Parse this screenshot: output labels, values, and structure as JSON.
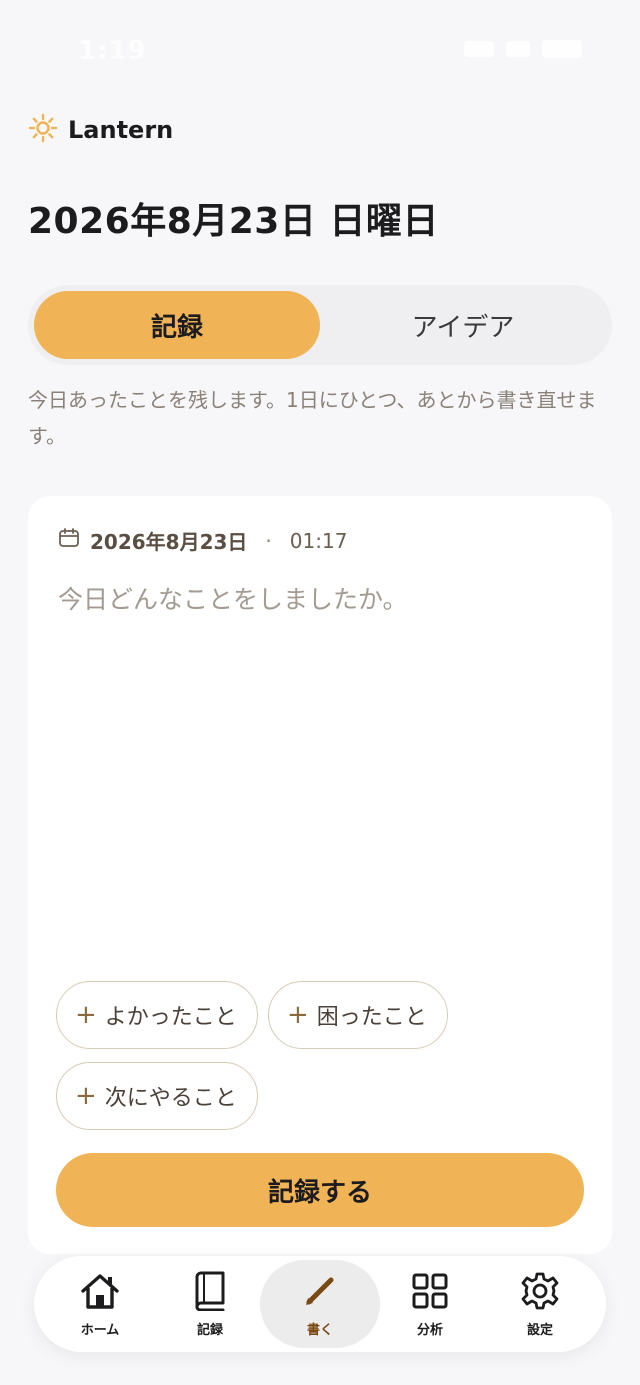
{
  "status": {
    "time": "1:19"
  },
  "brand": {
    "name": "Lantern",
    "icon": "sun-icon",
    "accent": "#f0b355"
  },
  "header": {
    "title": "2026年8月23日 日曜日"
  },
  "mode_tabs": [
    {
      "label": "記録",
      "active": true
    },
    {
      "label": "アイデア",
      "active": false
    }
  ],
  "description": "今日あったことを残します。1日にひとつ、あとから書き直せます。",
  "entry": {
    "date": "2026年8月23日",
    "separator": "·",
    "time": "01:17",
    "placeholder": "今日どんなことをしましたか。",
    "value": ""
  },
  "chips": [
    {
      "icon": "+",
      "label": "よかったこと"
    },
    {
      "icon": "+",
      "label": "困ったこと"
    },
    {
      "icon": "+",
      "label": "次にやること"
    }
  ],
  "submit": {
    "label": "記録する"
  },
  "nav": [
    {
      "label": "ホーム",
      "icon": "home-icon",
      "active": false
    },
    {
      "label": "記録",
      "icon": "book-icon",
      "active": false
    },
    {
      "label": "書く",
      "icon": "pencil-icon",
      "active": true
    },
    {
      "label": "分析",
      "icon": "grid-icon",
      "active": false
    },
    {
      "label": "設定",
      "icon": "gear-icon",
      "active": false
    }
  ]
}
